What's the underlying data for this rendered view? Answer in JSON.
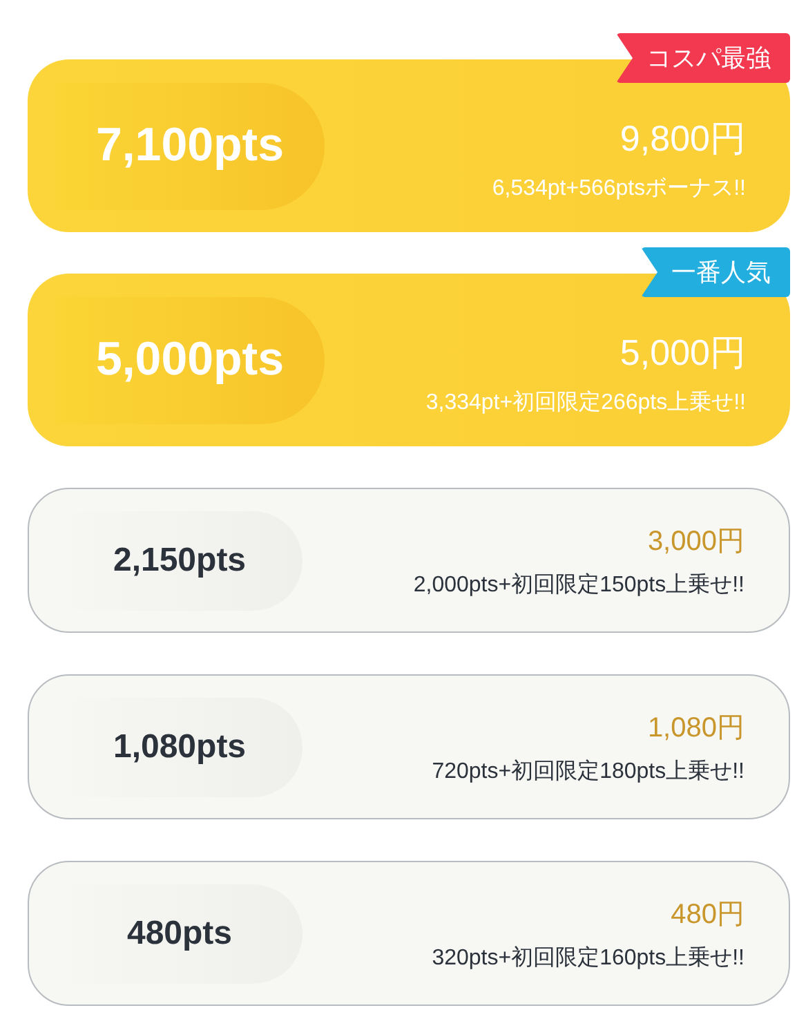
{
  "plans": [
    {
      "kind": "featured",
      "points": "7,100pts",
      "price": "9,800円",
      "detail": "6,534pt+566ptsボーナス!!",
      "badge": {
        "label": "コスパ最強",
        "color": "#f2394f"
      }
    },
    {
      "kind": "featured",
      "points": "5,000pts",
      "price": "5,000円",
      "detail": "3,334pt+初回限定266pts上乗せ!!",
      "badge": {
        "label": "一番人気",
        "color": "#22aede"
      }
    },
    {
      "kind": "standard",
      "points": "2,150pts",
      "price": "3,000円",
      "detail": "2,000pts+初回限定150pts上乗せ!!"
    },
    {
      "kind": "standard",
      "points": "1,080pts",
      "price": "1,080円",
      "detail": "720pts+初回限定180pts上乗せ!!"
    },
    {
      "kind": "standard",
      "points": "480pts",
      "price": "480円",
      "detail": "320pts+初回限定160pts上乗せ!!"
    }
  ]
}
